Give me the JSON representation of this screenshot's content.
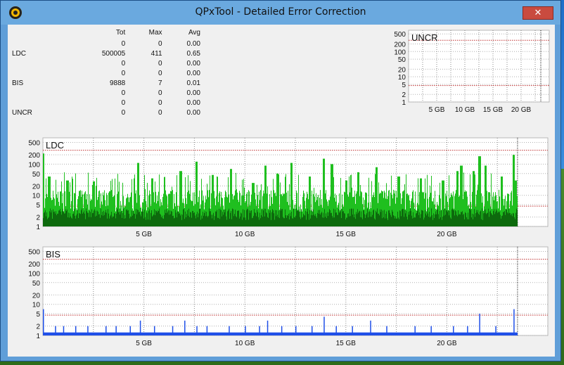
{
  "window": {
    "title": "QPxTool - Detailed Error Correction",
    "close_label": "✕"
  },
  "stats": {
    "headers": [
      "",
      "Tot",
      "Max",
      "Avg"
    ],
    "rows": [
      {
        "label": "",
        "tot": "0",
        "max": "0",
        "avg": "0.00"
      },
      {
        "label": "LDC",
        "tot": "500005",
        "max": "411",
        "avg": "0.65"
      },
      {
        "label": "",
        "tot": "0",
        "max": "0",
        "avg": "0.00"
      },
      {
        "label": "",
        "tot": "0",
        "max": "0",
        "avg": "0.00"
      },
      {
        "label": "BIS",
        "tot": "9888",
        "max": "7",
        "avg": "0.01"
      },
      {
        "label": "",
        "tot": "0",
        "max": "0",
        "avg": "0.00"
      },
      {
        "label": "",
        "tot": "0",
        "max": "0",
        "avg": "0.00"
      },
      {
        "label": "UNCR",
        "tot": "0",
        "max": "0",
        "avg": "0.00"
      }
    ]
  },
  "colors": {
    "ldc_bar": "#1fbf1f",
    "ldc_dark": "#0d6a0d",
    "bis_bar": "#1f4fe8",
    "threshold": "#c03030",
    "grid": "#a0a0a0"
  },
  "chart_data": [
    {
      "type": "bar",
      "title": "UNCR",
      "y_scale": "log",
      "y_ticks": [
        "500",
        "200",
        "100",
        "50",
        "20",
        "10",
        "5",
        "2",
        "1"
      ],
      "x_ticks": [
        "5 GB",
        "10 GB",
        "15 GB",
        "20 GB"
      ],
      "xlim": [
        0,
        25
      ],
      "ylim": [
        1,
        700
      ],
      "threshold_upper": 280,
      "threshold_lower": 4.5,
      "data_end_gb": 23.5,
      "series": [
        {
          "values": []
        }
      ],
      "grid": true
    },
    {
      "type": "bar",
      "title": "LDC",
      "y_scale": "log",
      "y_ticks": [
        "500",
        "200",
        "100",
        "50",
        "20",
        "10",
        "5",
        "2",
        "1"
      ],
      "x_ticks": [
        "5 GB",
        "10 GB",
        "15 GB",
        "20 GB"
      ],
      "xlim": [
        0,
        25
      ],
      "ylim": [
        1,
        700
      ],
      "threshold_upper": 280,
      "threshold_lower": 4.5,
      "data_end_gb": 23.5,
      "max_value": 411,
      "series": [
        {
          "values": [
            {
              "gb": 0.0,
              "v": 220
            },
            {
              "gb": 0.3,
              "v": 40
            },
            {
              "gb": 1.2,
              "v": 30
            },
            {
              "gb": 2.5,
              "v": 28
            },
            {
              "gb": 4.7,
              "v": 110
            },
            {
              "gb": 5.4,
              "v": 35
            },
            {
              "gb": 6.8,
              "v": 60
            },
            {
              "gb": 7.6,
              "v": 120
            },
            {
              "gb": 8.4,
              "v": 45
            },
            {
              "gb": 9.3,
              "v": 70
            },
            {
              "gb": 10.4,
              "v": 25
            },
            {
              "gb": 11.0,
              "v": 90
            },
            {
              "gb": 11.6,
              "v": 50
            },
            {
              "gb": 12.3,
              "v": 110
            },
            {
              "gb": 13.2,
              "v": 40
            },
            {
              "gb": 13.9,
              "v": 150
            },
            {
              "gb": 14.3,
              "v": 100
            },
            {
              "gb": 15.0,
              "v": 30
            },
            {
              "gb": 15.6,
              "v": 55
            },
            {
              "gb": 16.5,
              "v": 80
            },
            {
              "gb": 17.6,
              "v": 40
            },
            {
              "gb": 18.7,
              "v": 35
            },
            {
              "gb": 19.8,
              "v": 30
            },
            {
              "gb": 20.5,
              "v": 60
            },
            {
              "gb": 20.7,
              "v": 90
            },
            {
              "gb": 21.3,
              "v": 60
            },
            {
              "gb": 21.6,
              "v": 180
            },
            {
              "gb": 21.9,
              "v": 90
            },
            {
              "gb": 22.7,
              "v": 40
            },
            {
              "gb": 23.3,
              "v": 200
            },
            {
              "gb": 23.4,
              "v": 30
            }
          ]
        }
      ],
      "grid": true
    },
    {
      "type": "bar",
      "title": "BIS",
      "y_scale": "log",
      "y_ticks": [
        "500",
        "200",
        "100",
        "50",
        "20",
        "10",
        "5",
        "2",
        "1"
      ],
      "x_ticks": [
        "5 GB",
        "10 GB",
        "15 GB",
        "20 GB"
      ],
      "xlim": [
        0,
        25
      ],
      "ylim": [
        1,
        700
      ],
      "threshold_upper": 280,
      "threshold_lower": 4.5,
      "data_end_gb": 23.5,
      "max_value": 7,
      "series": [
        {
          "values": [
            {
              "gb": 0.0,
              "v": 7
            },
            {
              "gb": 0.6,
              "v": 2
            },
            {
              "gb": 1.0,
              "v": 2
            },
            {
              "gb": 1.6,
              "v": 2
            },
            {
              "gb": 2.2,
              "v": 2
            },
            {
              "gb": 3.1,
              "v": 2
            },
            {
              "gb": 3.6,
              "v": 2
            },
            {
              "gb": 4.3,
              "v": 2
            },
            {
              "gb": 4.8,
              "v": 3
            },
            {
              "gb": 5.5,
              "v": 2
            },
            {
              "gb": 6.4,
              "v": 2
            },
            {
              "gb": 7.0,
              "v": 3
            },
            {
              "gb": 7.6,
              "v": 2
            },
            {
              "gb": 8.1,
              "v": 2
            },
            {
              "gb": 9.2,
              "v": 2
            },
            {
              "gb": 10.0,
              "v": 2
            },
            {
              "gb": 10.7,
              "v": 2
            },
            {
              "gb": 11.1,
              "v": 3
            },
            {
              "gb": 11.8,
              "v": 2
            },
            {
              "gb": 12.5,
              "v": 2
            },
            {
              "gb": 13.3,
              "v": 2
            },
            {
              "gb": 13.9,
              "v": 4
            },
            {
              "gb": 14.5,
              "v": 2
            },
            {
              "gb": 15.3,
              "v": 2
            },
            {
              "gb": 16.2,
              "v": 3
            },
            {
              "gb": 17.0,
              "v": 2
            },
            {
              "gb": 18.4,
              "v": 2
            },
            {
              "gb": 19.2,
              "v": 2
            },
            {
              "gb": 20.3,
              "v": 2
            },
            {
              "gb": 21.0,
              "v": 2
            },
            {
              "gb": 21.6,
              "v": 5
            },
            {
              "gb": 22.4,
              "v": 2
            },
            {
              "gb": 23.3,
              "v": 7
            }
          ]
        }
      ],
      "grid": true
    }
  ]
}
